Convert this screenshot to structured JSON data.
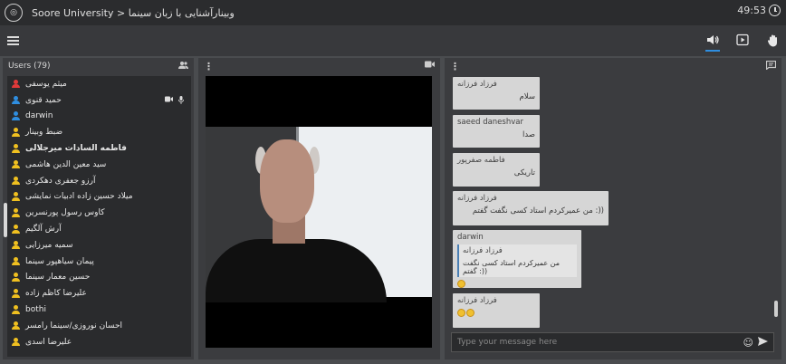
{
  "header": {
    "title": "Soore University > وبینارآشنایی با زبان سینما",
    "time": "49:53"
  },
  "toolbar": {
    "icons": [
      "menu-icon",
      "speaker-icon",
      "play-box-icon",
      "hand-icon"
    ]
  },
  "users": {
    "title": "Users (79)",
    "list": [
      {
        "name": "میثم یوسفی",
        "color": "#e03a3a",
        "bold": false
      },
      {
        "name": "حمید قنوی",
        "color": "#2f8ee0",
        "bold": false,
        "media": true
      },
      {
        "name": "darwin",
        "color": "#2f8ee0",
        "bold": false
      },
      {
        "name": "ضبط وبینار",
        "color": "#f0c020",
        "bold": false
      },
      {
        "name": "فاطمه السادات میرجلالی",
        "color": "#f0c020",
        "bold": true
      },
      {
        "name": "سید معین الدین هاشمی",
        "color": "#f0c020",
        "bold": false
      },
      {
        "name": "آرزو جعفری دهکردی",
        "color": "#f0c020",
        "bold": false
      },
      {
        "name": "میلاد حسین زاده ادبیات نمایشی",
        "color": "#f0c020",
        "bold": false
      },
      {
        "name": "کاوس رسول پورنسرین",
        "color": "#f0c020",
        "bold": false
      },
      {
        "name": "آرش آلگیم",
        "color": "#f0c020",
        "bold": false
      },
      {
        "name": "سمیه میرزایی",
        "color": "#f0c020",
        "bold": false
      },
      {
        "name": "پیمان سیاهپور سینما",
        "color": "#f0c020",
        "bold": false
      },
      {
        "name": "حسین معمار سینما",
        "color": "#f0c020",
        "bold": false
      },
      {
        "name": "علیرضا کاظم زاده",
        "color": "#f0c020",
        "bold": false
      },
      {
        "name": "bothi",
        "color": "#f0c020",
        "bold": false
      },
      {
        "name": "احسان نوروزی/سینما رامسر",
        "color": "#f0c020",
        "bold": false
      },
      {
        "name": "علیرضا اسدی",
        "color": "#f0c020",
        "bold": false
      }
    ]
  },
  "chat": {
    "messages": [
      {
        "sender": "فرزاد فرزانه",
        "text": "سلام"
      },
      {
        "sender": "saeed daneshvar",
        "text": "صدا"
      },
      {
        "sender": "فاطمه صفرپور",
        "text": "تاریکی"
      },
      {
        "sender": "فرزاد فرزانه",
        "text": "من عمیرکردم استاد کسی نگفت گفتم :))"
      },
      {
        "sender": "darwin",
        "quote_sender": "فرزاد فرزانه",
        "quote_text": "من عمیرکردم استاد کسی نگفت گفتم :))"
      },
      {
        "sender": "فرزاد فرزانه",
        "text": ""
      }
    ],
    "placeholder": "Type your message here"
  }
}
